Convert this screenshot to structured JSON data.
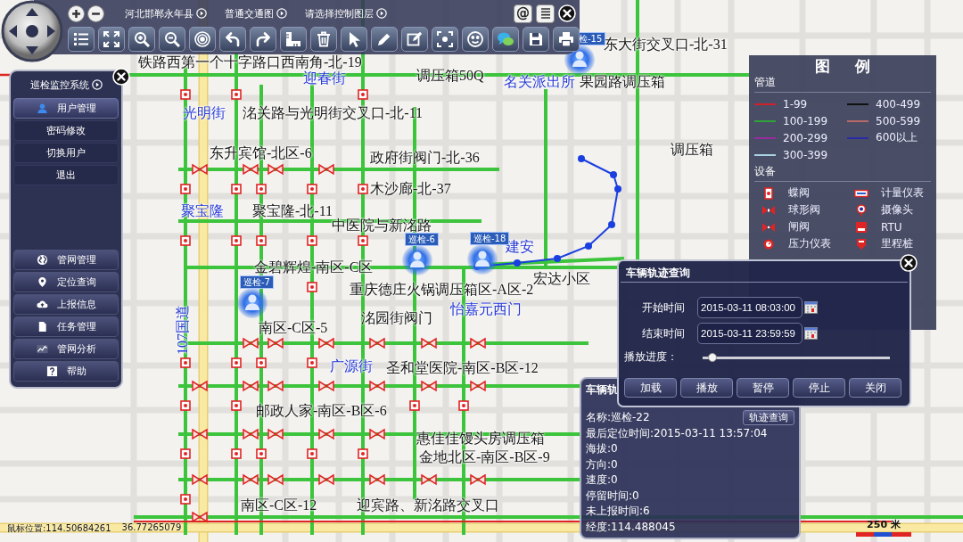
{
  "toolbar": {
    "region": "河北邯郸永年县",
    "map_type": "普通交通图",
    "layer": "请选择控制图层",
    "at_button": "@"
  },
  "side_panel": {
    "title": "巡检监控系统",
    "user_group": {
      "label": "用户管理",
      "expanded": true,
      "items": [
        "密码修改",
        "切换用户",
        "退出"
      ]
    },
    "nav_items": [
      "管网管理",
      "定位查询",
      "上报信息",
      "任务管理",
      "管网分析",
      "帮助"
    ]
  },
  "map_labels": [
    {
      "text": "铁路西第一个十字路口西南角-北-19",
      "kind": "site"
    },
    {
      "text": "东大街交叉口-北-31",
      "kind": "site"
    },
    {
      "text": "迎春街",
      "kind": "street"
    },
    {
      "text": "调压箱50Q",
      "kind": "site"
    },
    {
      "text": "名关派出所",
      "kind": "street"
    },
    {
      "text": "果园路调压箱",
      "kind": "site"
    },
    {
      "text": "光明街",
      "kind": "street"
    },
    {
      "text": "洺关路与光明街交叉口-北-11",
      "kind": "site"
    },
    {
      "text": "调压箱",
      "kind": "site"
    },
    {
      "text": "东升宾馆-北区-6",
      "kind": "site"
    },
    {
      "text": "政府街阀门-北-36",
      "kind": "site"
    },
    {
      "text": "木沙廊-北-37",
      "kind": "site"
    },
    {
      "text": "聚宝隆",
      "kind": "street"
    },
    {
      "text": "聚宝隆-北-11",
      "kind": "site"
    },
    {
      "text": "中医院与新洺路",
      "kind": "site"
    },
    {
      "text": "建安",
      "kind": "street"
    },
    {
      "text": "宏达小区",
      "kind": "site"
    },
    {
      "text": "金碧辉煌-南区-C区",
      "kind": "site"
    },
    {
      "text": "重庆德庄火锅调压箱区-A区-2",
      "kind": "site"
    },
    {
      "text": "怡嘉元西门",
      "kind": "street"
    },
    {
      "text": "洺园街阀门",
      "kind": "site"
    },
    {
      "text": "南区-C区-5",
      "kind": "site"
    },
    {
      "text": "107国道",
      "kind": "road"
    },
    {
      "text": "广源街",
      "kind": "street"
    },
    {
      "text": "圣和堂医院-南区-B区-12",
      "kind": "site"
    },
    {
      "text": "邮政人家-南区-B区-6",
      "kind": "site"
    },
    {
      "text": "惠佳佳馒头房调压箱",
      "kind": "site"
    },
    {
      "text": "金地北区-南区-B区-9",
      "kind": "site"
    },
    {
      "text": "南区-C区-12",
      "kind": "site"
    },
    {
      "text": "迎宾路、新洺路交叉口",
      "kind": "site"
    }
  ],
  "patrol_markers": [
    {
      "label": "检-15"
    },
    {
      "label": "巡检-6"
    },
    {
      "label": "巡检-18"
    },
    {
      "label": "巡检-7"
    }
  ],
  "legend": {
    "title": "图 例",
    "pipe_heading": "管道",
    "pipes": [
      {
        "label": "1-99",
        "color": "#d0202a"
      },
      {
        "label": "100-199",
        "color": "#2fa33a"
      },
      {
        "label": "200-299",
        "color": "#9a2aa0"
      },
      {
        "label": "300-399",
        "color": "#a9d3e4"
      },
      {
        "label": "400-499",
        "color": "#111111"
      },
      {
        "label": "500-599",
        "color": "#b86a6a"
      },
      {
        "label": "600以上",
        "color": "#2a2aa8"
      }
    ],
    "device_heading": "设备",
    "devices": [
      "蝶阀",
      "球形阀",
      "闸阀",
      "压力仪表",
      "计量仪表",
      "摄像头",
      "RTU",
      "里程桩"
    ]
  },
  "track_dialog": {
    "title": "车辆轨迹查询",
    "fields": [
      {
        "label": "开始时间",
        "value": "2015-03-11 08:03:00"
      },
      {
        "label": "结束时间",
        "value": "2015-03-11 23:59:59"
      }
    ],
    "progress": {
      "label": "播放进度：",
      "level": 0.05
    },
    "buttons": [
      "加载",
      "播放",
      "暂停",
      "停止",
      "关闭"
    ]
  },
  "vehicle_panel": {
    "title": "车辆轨",
    "button": "轨迹查询",
    "lines": [
      "名称:巡检-22",
      "最后定位时间:2015-03-11 13:57:04",
      "海拔:0",
      "方向:0",
      "速度:0",
      "停留时间:0",
      "未上报时间:6",
      "经度:114.488045"
    ]
  },
  "status_bar": {
    "mouse_position": "鼠标位置:114.50684261",
    "latitude": "36.77265079"
  },
  "scale": {
    "label": "250 米"
  }
}
